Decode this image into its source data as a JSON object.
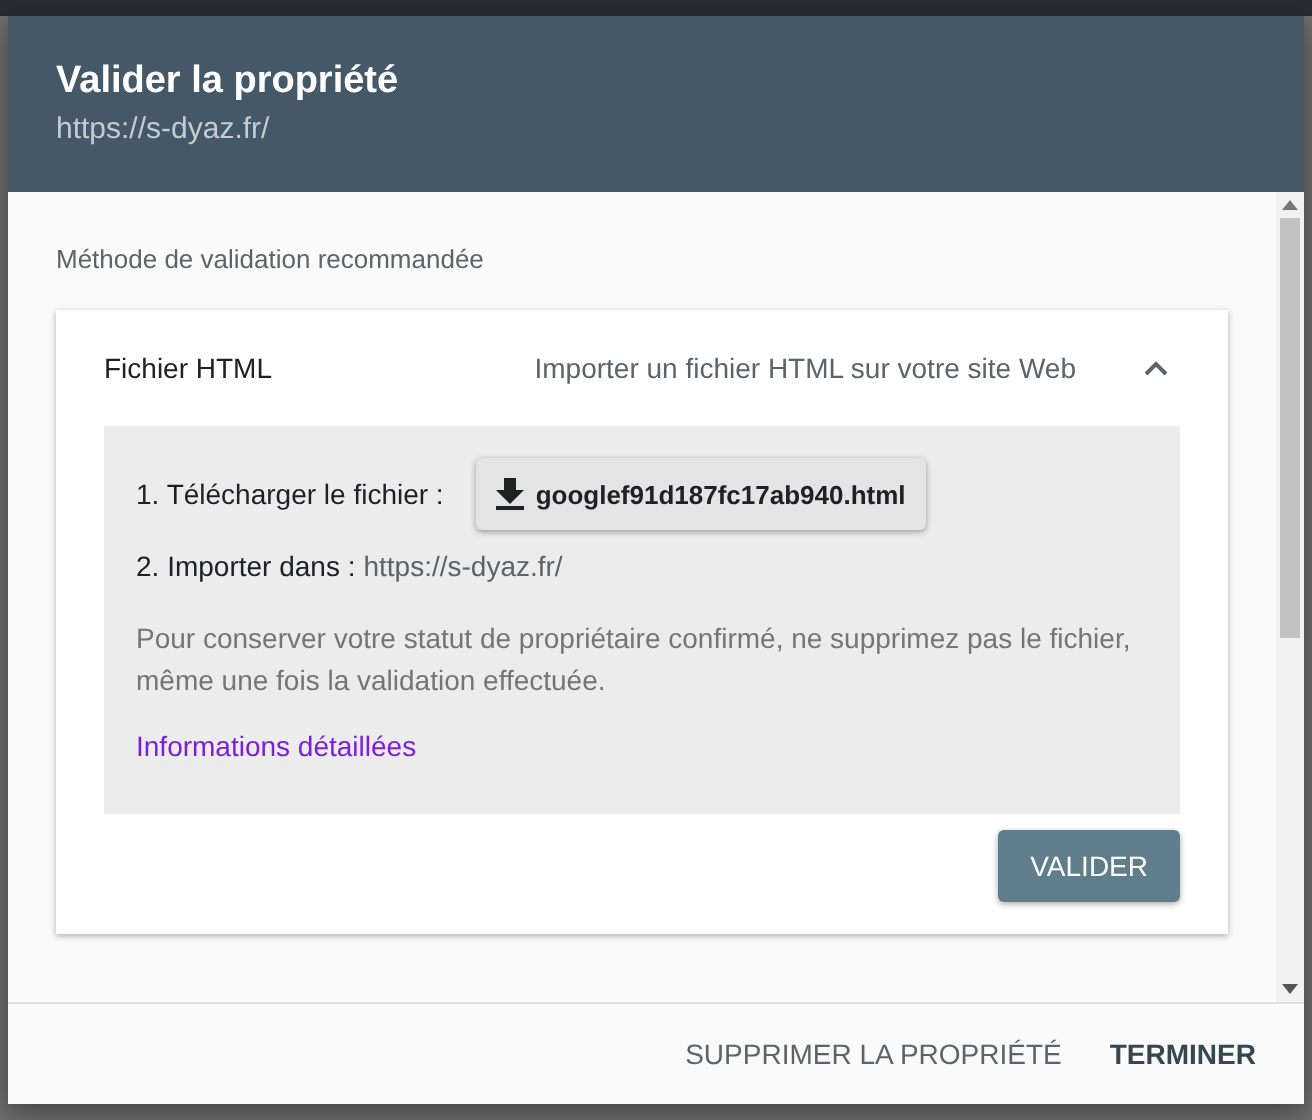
{
  "dialog": {
    "title": "Valider la propriété",
    "subtitle": "https://s-dyaz.fr/"
  },
  "section_label": "Méthode de validation recommandée",
  "method": {
    "name": "Fichier HTML",
    "description": "Importer un fichier HTML sur votre site Web",
    "expanded": true,
    "step_1": "1. Télécharger le fichier :",
    "download_button": "googlef91d187fc17ab940.html",
    "step_2_label": "2. Importer dans :",
    "step_2_url": "https://s-dyaz.fr/",
    "note": "Pour conserver votre statut de propriétaire confirmé, ne supprimez pas le fichier, même une fois la validation effectuée.",
    "link": "Informations détaillées",
    "validate_button": "VALIDER"
  },
  "footer_buttons": [
    {
      "label": "SUPPRIMER LA PROPRIÉTÉ",
      "kind": "secondary"
    },
    {
      "label": "TERMINER",
      "kind": "primary"
    }
  ]
}
